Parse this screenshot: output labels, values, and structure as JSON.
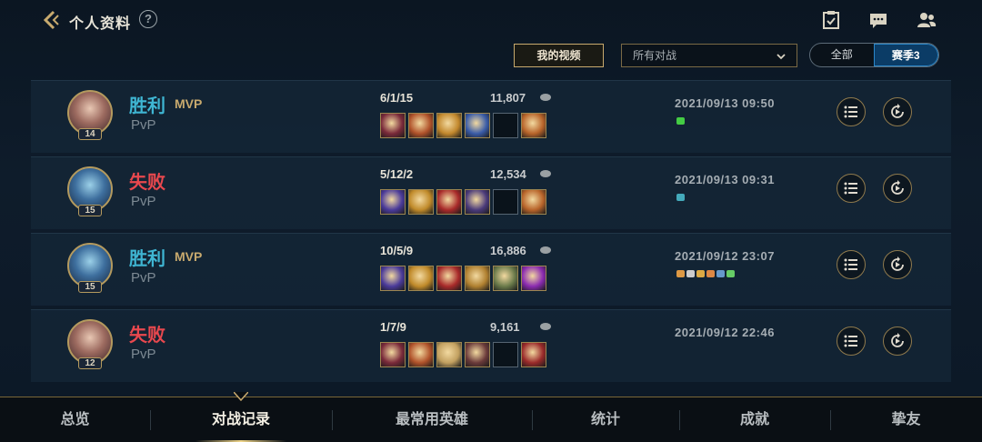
{
  "header": {
    "title": "个人资料",
    "help_label": "?"
  },
  "filters": {
    "video_button": "我的视频",
    "dropdown_value": "所有对战",
    "segments": [
      "全部",
      "赛季3"
    ],
    "active_segment": "赛季3"
  },
  "matches": [
    {
      "result": "胜利",
      "outcome": "win",
      "mvp": "MVP",
      "mode": "PvP",
      "level": "14",
      "kda": "6/1/15",
      "gold": "11,807",
      "date": "2021/09/13 09:50",
      "avatar": "gold",
      "items": [
        "#7a2a3a",
        "#b0522a",
        "#c2882d",
        "#3a5ca8",
        "empty",
        "#b8642a"
      ]
    },
    {
      "result": "失败",
      "outcome": "lose",
      "mvp": "",
      "mode": "PvP",
      "level": "15",
      "kda": "5/12/2",
      "gold": "12,534",
      "date": "2021/09/13 09:31",
      "avatar": "blue",
      "items": [
        "#4a3a9a",
        "#c08a2a",
        "#a82a2a",
        "#4a3a7a",
        "empty",
        "#b8642a"
      ]
    },
    {
      "result": "胜利",
      "outcome": "win",
      "mvp": "MVP",
      "mode": "PvP",
      "level": "15",
      "kda": "10/5/9",
      "gold": "16,886",
      "date": "2021/09/12 23:07",
      "avatar": "blue",
      "items": [
        "#4a3a9a",
        "#c08a2a",
        "#a82a2a",
        "#b08030",
        "#6a7a4a",
        "#8a2ab0"
      ]
    },
    {
      "result": "失败",
      "outcome": "lose",
      "mvp": "",
      "mode": "PvP",
      "level": "12",
      "kda": "1/7/9",
      "gold": "9,161",
      "date": "2021/09/12 22:46",
      "avatar": "gold",
      "items": [
        "#7a2a3a",
        "#b0522a",
        "#c2a060",
        "#6a3a3a",
        "empty",
        "#9a2a2a"
      ]
    }
  ],
  "nav": {
    "tabs": [
      "总览",
      "对战记录",
      "最常用英雄",
      "统计",
      "成就",
      "挚友"
    ],
    "active": "对战记录"
  },
  "colors": {
    "accent_gold": "#c8aa6e",
    "win": "#3fb6d3",
    "lose": "#e8484e"
  }
}
